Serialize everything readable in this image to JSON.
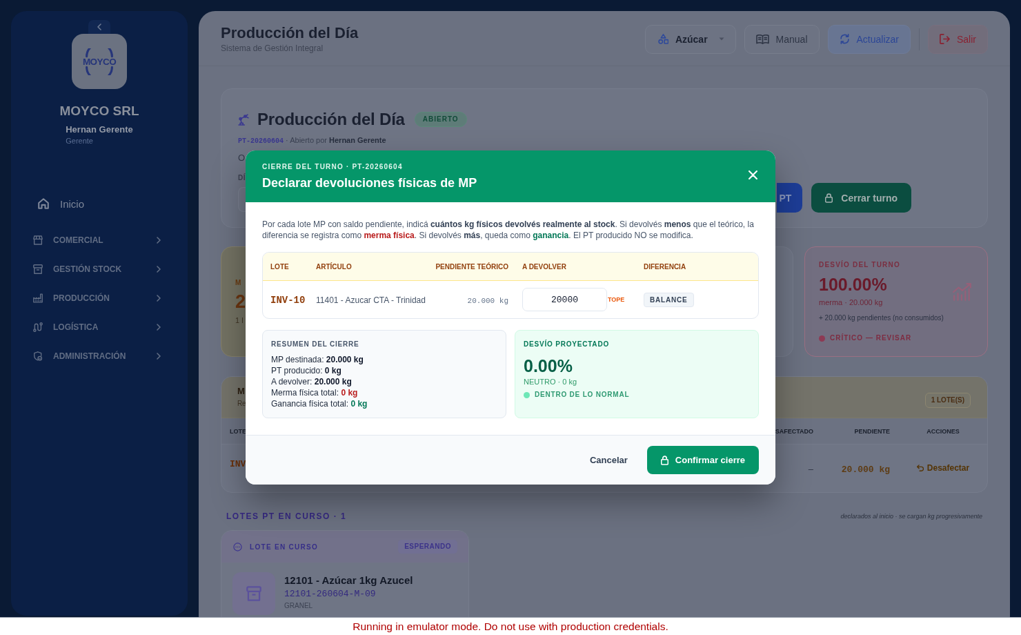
{
  "sidebar": {
    "logo": {
      "text": "MOYCO"
    },
    "company": "MOYCO SRL",
    "user": {
      "name": "Hernan Gerente",
      "role": "Gerente"
    },
    "items": [
      {
        "label": "Inicio",
        "kind": "link"
      },
      {
        "label": "COMERCIAL",
        "kind": "group"
      },
      {
        "label": "GESTIÓN STOCK",
        "kind": "group"
      },
      {
        "label": "PRODUCCIÓN",
        "kind": "group"
      },
      {
        "label": "LOGÍSTICA",
        "kind": "group"
      },
      {
        "label": "ADMINISTRACIÓN",
        "kind": "group"
      }
    ]
  },
  "header": {
    "title": "Producción del Día",
    "subtitle": "Sistema de Gestión Integral",
    "actions": [
      {
        "label": "Azúcar",
        "kind": "dropdown"
      },
      {
        "label": "Manual",
        "kind": "outline"
      },
      {
        "label": "Actualizar",
        "kind": "primary"
      },
      {
        "label": "Salir",
        "kind": "danger"
      }
    ]
  },
  "shift_card": {
    "title": "Producción del Día",
    "status": "ABIERTO",
    "meta": [
      {
        "kind": "code",
        "text": "PT-20260604"
      },
      {
        "kind": "plain",
        "text": " · Abierto por "
      },
      {
        "kind": "strong",
        "text": "Hernan Gerente"
      }
    ],
    "description": "O",
    "field_label": "DÍ",
    "actions": [
      {
        "label": "PT",
        "kind": "blue"
      },
      {
        "label": "Cerrar turno",
        "kind": "green"
      }
    ]
  },
  "stats": {
    "mp": {
      "label": "M",
      "value": "2",
      "note": "1 l"
    },
    "deviation": {
      "label": "DESVÍO DEL TURNO",
      "value": "100.00%",
      "detail": "merma · 20.000 kg",
      "note": "+ 20.000 kg pendientes (no consumidos)",
      "status": "CRÍTICO — REVISAR",
      "kind": "critical"
    }
  },
  "lots_table": {
    "title": "M",
    "subtitle": "Re",
    "count": "1 LOTE(S)",
    "columns": [
      "LOTE",
      "SAFECTADO",
      "PENDIENTE",
      "ACCIONES"
    ],
    "rows": [
      {
        "lot": "INV",
        "desafectado": "–",
        "pending": "20.000 kg",
        "action": "Desafectar"
      }
    ]
  },
  "lots_in_progress": {
    "heading": "LOTES PT EN CURSO · 1",
    "note": "declarados al inicio · se cargan kg progresivamente",
    "items": [
      {
        "header": "LOTE EN CURSO",
        "status": "ESPERANDO",
        "name": "12101 - Azúcar 1kg Azucel",
        "code": "12101-260604-M-09",
        "type": "GRANEL"
      }
    ]
  },
  "modal": {
    "kicker": "CIERRE DEL TURNO · PT-20260604",
    "title": "Declarar devoluciones físicas de MP",
    "intro": [
      {
        "kind": "plain",
        "text": "Por cada lote MP con saldo pendiente, indicá "
      },
      {
        "kind": "strong",
        "text": "cuántos kg físicos devolvés realmente al stock"
      },
      {
        "kind": "plain",
        "text": ". Si devolvés "
      },
      {
        "kind": "strong",
        "text": "menos"
      },
      {
        "kind": "plain",
        "text": " que el teórico, la diferencia se registra como "
      },
      {
        "kind": "loss",
        "text": "merma física"
      },
      {
        "kind": "plain",
        "text": ". Si devolvés "
      },
      {
        "kind": "strong",
        "text": "más"
      },
      {
        "kind": "plain",
        "text": ", queda como "
      },
      {
        "kind": "gain",
        "text": "ganancia"
      },
      {
        "kind": "plain",
        "text": ". El PT producido NO se modifica."
      }
    ],
    "table": {
      "columns": [
        "LOTE",
        "ARTÍCULO",
        "PENDIENTE TEÓRICO",
        "A DEVOLVER",
        "DIFERENCIA"
      ],
      "rows": [
        {
          "lot": "INV-10",
          "article": "11401 - Azucar CTA - Trinidad",
          "pending": "20.000 kg",
          "return_value": "20000",
          "limit_flag": "TOPE",
          "difference": "BALANCE"
        }
      ]
    },
    "summary": {
      "title": "RESUMEN DEL CIERRE",
      "lines": [
        {
          "label": "MP destinada:",
          "value": "20.000 kg",
          "kind": "plain"
        },
        {
          "label": "PT producido:",
          "value": "0 kg",
          "kind": "plain"
        },
        {
          "label": "A devolver:",
          "value": "20.000 kg",
          "kind": "plain"
        },
        {
          "label": "Merma física total:",
          "value": "0 kg",
          "kind": "loss"
        },
        {
          "label": "Ganancia física total:",
          "value": "0 kg",
          "kind": "gain"
        }
      ]
    },
    "projection": {
      "title": "DESVÍO PROYECTADO",
      "value": "0.00%",
      "detail": "NEUTRO · 0 kg",
      "status": "DENTRO DE LO NORMAL",
      "kind": "normal"
    },
    "actions": [
      {
        "label": "Cancelar",
        "kind": "text"
      },
      {
        "label": "Confirmar cierre",
        "kind": "primary"
      }
    ]
  },
  "banner": "Running in emulator mode. Do not use with production credentials."
}
